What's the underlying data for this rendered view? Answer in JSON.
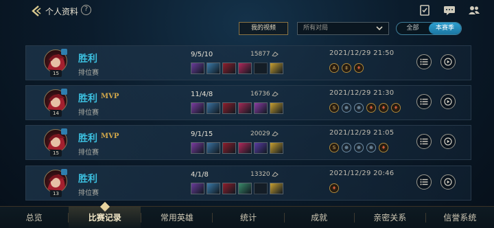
{
  "header": {
    "title": "个人资料",
    "help_icon": "?",
    "icons": [
      "checklist-icon",
      "chat-icon",
      "friends-icon"
    ]
  },
  "filters": {
    "my_videos": "我的视频",
    "mode_select": "所有对局",
    "segment": [
      "全部",
      "本赛季"
    ],
    "segment_active": "本赛季"
  },
  "matches": [
    {
      "result": "胜利",
      "mvp": "",
      "mode": "排位赛",
      "level": "15",
      "kda": "9/5/10",
      "score": "15877",
      "date": "2021/12/29 21:50",
      "items": [
        "#6a3c9a",
        "#3a7aa8",
        "#8f1e2c",
        "#b0285a",
        "",
        "#c8a030"
      ],
      "medals": [
        {
          "t": "A",
          "c": "gold"
        },
        {
          "t": "‡",
          "c": "gold"
        },
        {
          "t": "♦",
          "c": "red"
        }
      ]
    },
    {
      "result": "胜利",
      "mvp": "MVP",
      "mode": "排位赛",
      "level": "14",
      "kda": "11/4/8",
      "score": "16736",
      "date": "2021/12/29 21:30",
      "items": [
        "#7a3ca0",
        "#3a72a0",
        "#8f1e2c",
        "#a42a56",
        "#8a3ca2",
        "#c8a030"
      ],
      "medals": [
        {
          "t": "S",
          "c": "gold"
        },
        {
          "t": "⊕",
          "c": "blue"
        },
        {
          "t": "⊕",
          "c": "blue"
        },
        {
          "t": "♦",
          "c": "red"
        },
        {
          "t": "♦",
          "c": "red"
        },
        {
          "t": "♦",
          "c": "red"
        }
      ]
    },
    {
      "result": "胜利",
      "mvp": "MVP",
      "mode": "排位赛",
      "level": "15",
      "kda": "9/1/15",
      "score": "20029",
      "date": "2021/12/29 21:05",
      "items": [
        "#7a3ca0",
        "#3a72a0",
        "#8f1e2c",
        "#b0285a",
        "#5a3ca2",
        "#c8a030"
      ],
      "medals": [
        {
          "t": "S",
          "c": "gold"
        },
        {
          "t": "⊕",
          "c": "blue"
        },
        {
          "t": "⊕",
          "c": "blue"
        },
        {
          "t": "⊕",
          "c": "blue"
        },
        {
          "t": "♦",
          "c": "red"
        }
      ]
    },
    {
      "result": "胜利",
      "mvp": "",
      "mode": "排位赛",
      "level": "13",
      "kda": "4/1/8",
      "score": "13320",
      "date": "2021/12/29 20:46",
      "items": [
        "#6a3c9a",
        "#3a7aa8",
        "#8f1e2c",
        "#3a8a6a",
        "",
        "#c8a030"
      ],
      "medals": [
        {
          "t": "♦",
          "c": "red"
        }
      ]
    }
  ],
  "nav": {
    "tabs": [
      "总览",
      "比赛记录",
      "常用英雄",
      "统计",
      "成就",
      "亲密关系",
      "信誉系统"
    ],
    "active": "比赛记录"
  }
}
